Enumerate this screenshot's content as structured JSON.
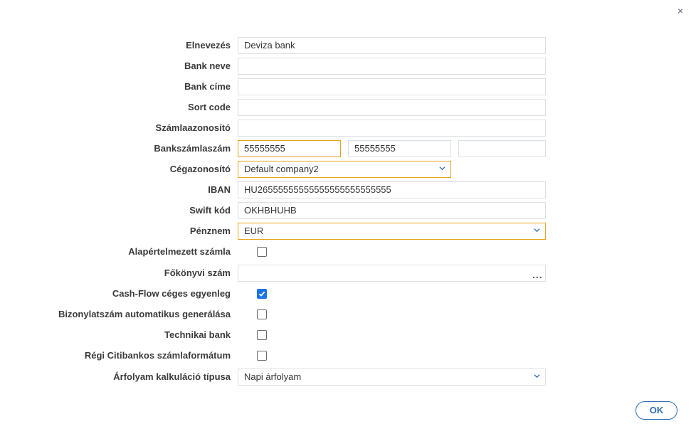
{
  "dialog": {
    "close_icon": "×",
    "ok_label": "OK"
  },
  "form": {
    "elnevezes": {
      "label": "Elnevezés",
      "value": "Deviza bank"
    },
    "bank_neve": {
      "label": "Bank neve",
      "value": ""
    },
    "bank_cime": {
      "label": "Bank címe",
      "value": ""
    },
    "sort_code": {
      "label": "Sort code",
      "value": ""
    },
    "szamlaazonosito": {
      "label": "Számlaazonosító",
      "value": ""
    },
    "bankszamlaszam": {
      "label": "Bankszámlaszám",
      "part1": "55555555",
      "part2": "55555555",
      "part3": ""
    },
    "cegazonosito": {
      "label": "Cégazonosító",
      "value": "Default company2"
    },
    "iban": {
      "label": "IBAN",
      "value": "HU26555555555555555555555555"
    },
    "swift": {
      "label": "Swift kód",
      "value": "OKHBHUHB"
    },
    "penznem": {
      "label": "Pénznem",
      "value": "EUR"
    },
    "alapertelmezett": {
      "label": "Alapértelmezett számla",
      "checked": false
    },
    "fokonyvi": {
      "label": "Főkönyvi szám",
      "value": "",
      "dots": "..."
    },
    "cashflow": {
      "label": "Cash-Flow céges egyenleg",
      "checked": true
    },
    "bizonylatszam": {
      "label": "Bizonylatszám automatikus generálása",
      "checked": false
    },
    "technikai": {
      "label": "Technikai bank",
      "checked": false
    },
    "regi_citi": {
      "label": "Régi Citibankos számlaformátum",
      "checked": false
    },
    "arfolyam": {
      "label": "Árfolyam kalkuláció típusa",
      "value": "Napi árfolyam"
    }
  },
  "colors": {
    "accent_orange": "#e8a21a",
    "checkbox_blue": "#1a73e8",
    "ok_blue": "#2e6fb7"
  }
}
